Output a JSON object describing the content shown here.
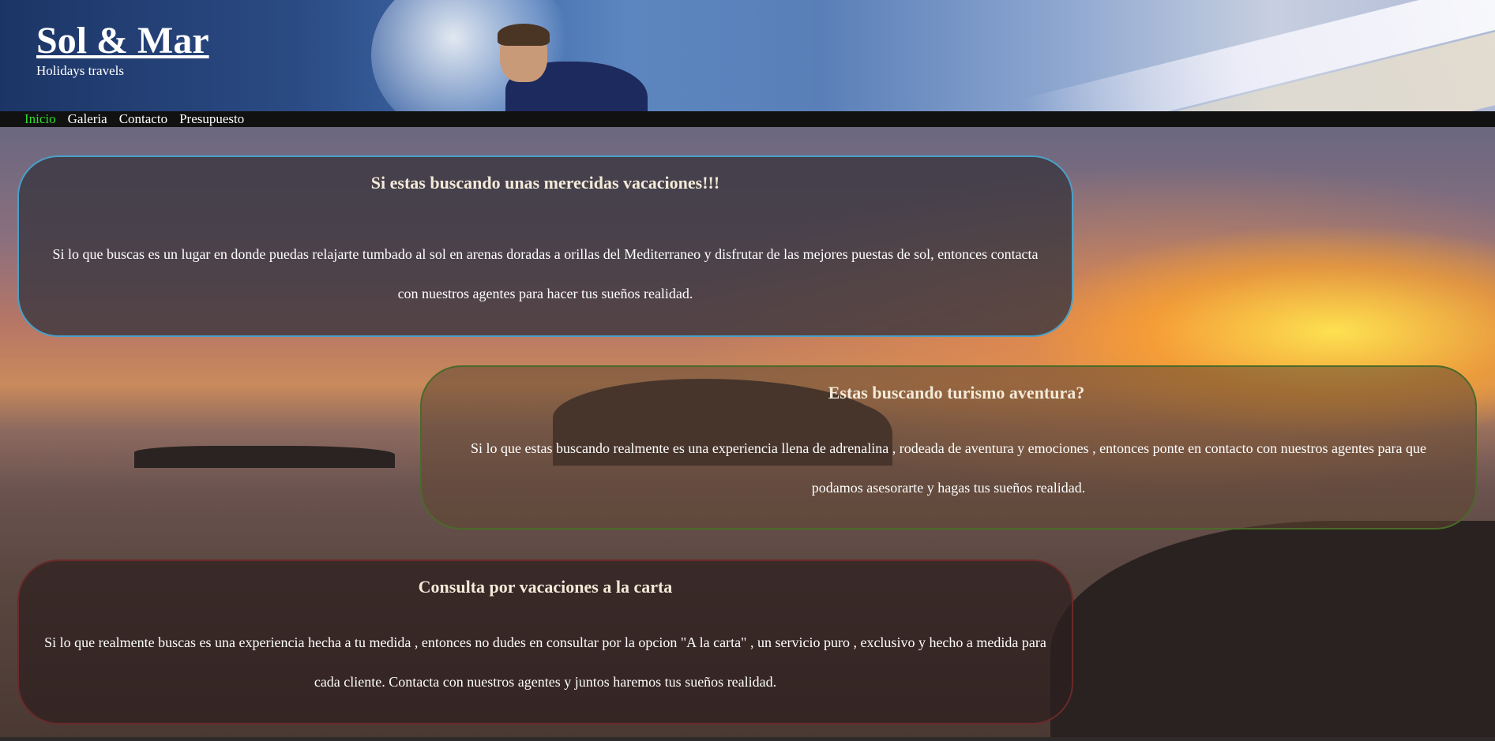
{
  "header": {
    "title": "Sol & Mar",
    "subtitle": "Holidays travels"
  },
  "nav": {
    "items": [
      {
        "label": "Inicio",
        "active": true
      },
      {
        "label": "Galeria",
        "active": false
      },
      {
        "label": "Contacto",
        "active": false
      },
      {
        "label": "Presupuesto",
        "active": false
      }
    ],
    "active_color": "#2fdc2f"
  },
  "sections": [
    {
      "title": "Si estas buscando unas merecidas vacaciones!!!",
      "body": "Si lo que buscas es un lugar en donde puedas relajarte tumbado al sol en arenas doradas a orillas del Mediterraneo y disfrutar de las mejores puestas de sol, entonces contacta con nuestros agentes para hacer tus sueños realidad.",
      "border_color": "#4aa0c8"
    },
    {
      "title": "Estas buscando turismo aventura?",
      "body": "Si lo que estas buscando realmente es una experiencia llena de adrenalina , rodeada de aventura y emociones , entonces ponte en contacto con nuestros agentes para que podamos asesorarte y hagas tus sueños realidad.",
      "border_color": "#4a6a28"
    },
    {
      "title": "Consulta por vacaciones a la carta",
      "body": "Si lo que realmente buscas es una experiencia hecha a tu medida , entonces no dudes en consultar por la opcion \"A la carta\" , un servicio puro , exclusivo y hecho a medida para cada cliente. Contacta con nuestros agentes y juntos haremos tus sueños realidad.",
      "border_color": "#6a2a2a"
    }
  ]
}
